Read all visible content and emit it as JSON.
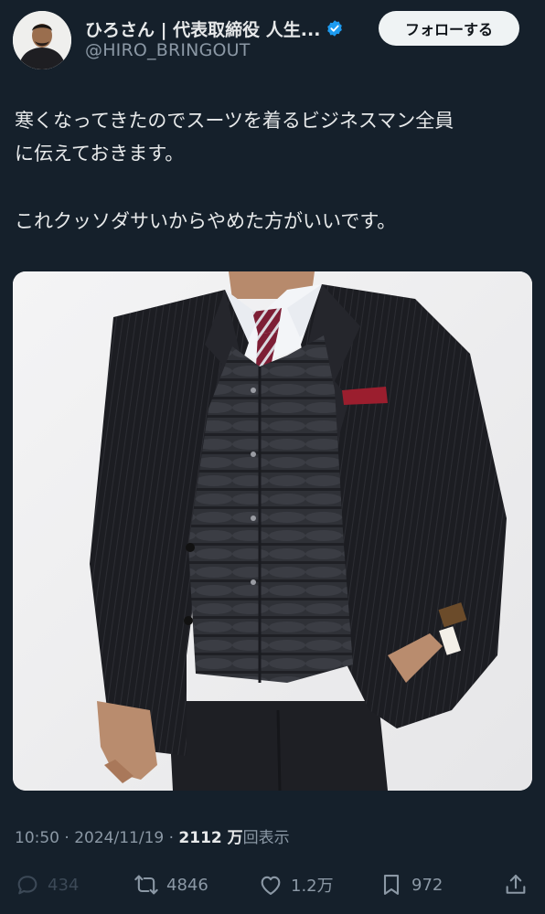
{
  "author": {
    "display_name": "ひろさん | 代表取締役 人生...",
    "handle": "@HIRO_BRINGOUT",
    "verified": true
  },
  "follow_button": {
    "label": "フォローする"
  },
  "tweet": {
    "lines": [
      "寒くなってきたのでスーツを着るビジネスマン全員",
      "に伝えておきます。",
      "これクッソダサいからやめた方がいいです。"
    ]
  },
  "meta": {
    "time": "10:50",
    "separator": " · ",
    "date": "2024/11/19",
    "views_count": "2112 万",
    "views_label": "回表示"
  },
  "actions": {
    "reply_count": "434",
    "retweet_count": "4846",
    "like_count": "1.2万",
    "bookmark_count": "972"
  },
  "colors": {
    "background": "#15202b",
    "verified": "#1d9bf0",
    "secondary_text": "#8b98a5"
  }
}
